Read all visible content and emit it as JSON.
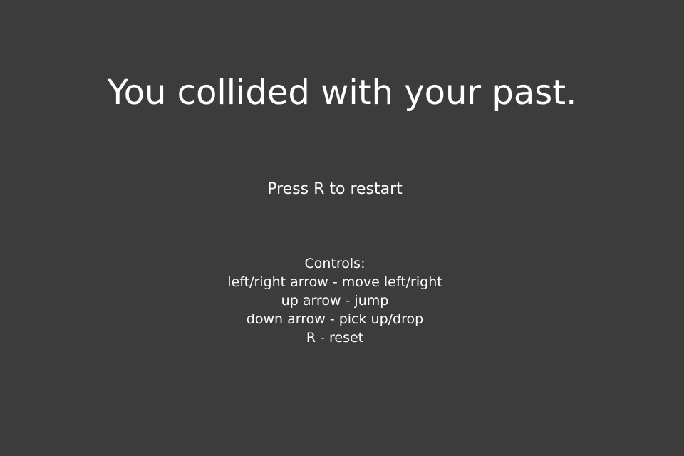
{
  "game_over": {
    "title": "You collided with your past.",
    "restart_prompt": "Press R to restart"
  },
  "controls": {
    "heading": "Controls:",
    "lines": [
      "left/right arrow - move left/right",
      "up arrow - jump",
      "down arrow - pick up/drop",
      "R - reset"
    ]
  }
}
